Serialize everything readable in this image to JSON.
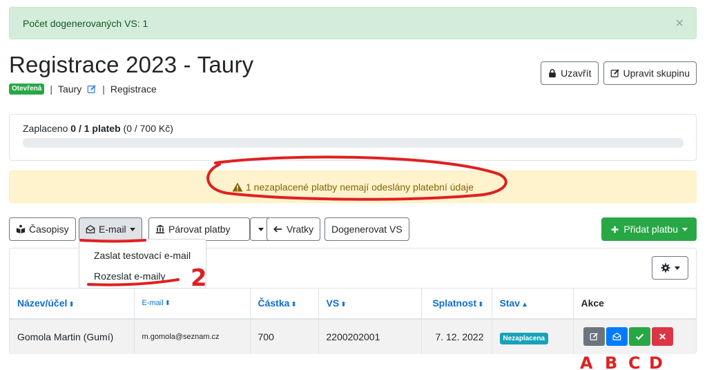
{
  "alert": {
    "text": "Počet dogenerovaných VS: 1",
    "close": "×"
  },
  "header": {
    "title": "Registrace 2023 - Taury",
    "status_badge": "Otevřená",
    "group_link": "Taury",
    "category": "Registrace",
    "close_button": "Uzavřít",
    "edit_button": "Upravit skupinu"
  },
  "payments": {
    "prefix": "Zaplaceno ",
    "count": "0 / 1 plateb",
    "amount": "(0 / 700 Kč)",
    "progress_fraction": 0
  },
  "warning": {
    "text": "1 nezaplacené platby nemají odeslány platební údaje"
  },
  "toolbar": {
    "journals": "Časopisy",
    "email": "E-mail",
    "pair": "Párovat platby",
    "refunds": "Vratky",
    "generate": "Dogenerovat VS",
    "add": "Přidat platbu"
  },
  "dropdown": {
    "items": [
      "Zaslat testovací e-mail",
      "Rozeslat e-maily"
    ]
  },
  "table": {
    "headers": [
      "Název/účel",
      "E-mail",
      "Částka",
      "VS",
      "Splatnost",
      "Stav",
      "Akce"
    ],
    "rows": [
      {
        "name": "Gomola Martin (Gumí)",
        "email": "m.gomola@seznam.cz",
        "amount": "700",
        "vs": "2200202001",
        "due": "7. 12. 2022",
        "status": "Nezaplacena"
      }
    ]
  },
  "annotations": {
    "number": "2",
    "labels": [
      "A",
      "B",
      "C",
      "D"
    ],
    "color": "#e02020"
  }
}
